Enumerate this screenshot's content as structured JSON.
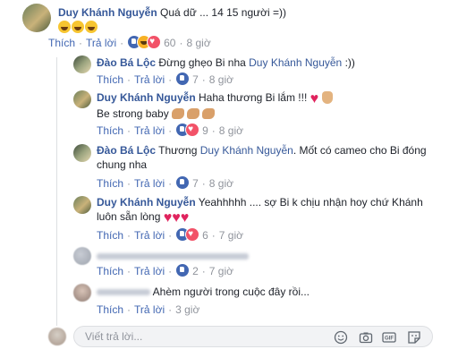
{
  "actions": {
    "like": "Thích",
    "reply": "Trả lời"
  },
  "comments": [
    {
      "author": "Duy Khánh Nguyễn",
      "text": "Quá dữ ... 14 15 người =))",
      "reaction_count": "60",
      "time": "8 giờ"
    },
    {
      "author": "Đào Bá Lộc",
      "text_before": "Đừng ghẹo Bi nha",
      "tag": "Duy Khánh Nguyễn",
      "text_after": ":))",
      "reaction_count": "7",
      "time": "8 giờ"
    },
    {
      "author": "Duy Khánh Nguyễn",
      "text": "Haha thương Bi lắm !!!",
      "line2": "Be strong baby",
      "reaction_count": "9",
      "time": "8 giờ"
    },
    {
      "author": "Đào Bá Lộc",
      "text_before": "Thương",
      "tag": "Duy Khánh Nguyễn",
      "text_after": ". Mốt có cameo cho Bi đóng",
      "line2": "chung nha",
      "reaction_count": "7",
      "time": "8 giờ"
    },
    {
      "author": "Duy Khánh Nguyễn",
      "text": "Yeahhhhh .... sợ Bi k chịu nhận hoy chứ Khánh",
      "line2": "luôn sẵn lòng",
      "reaction_count": "6",
      "time": "7 giờ"
    },
    {
      "reaction_count": "2",
      "time": "7 giờ"
    },
    {
      "text": "Ahèm người trong cuộc đây rồi...",
      "time": "3 giờ"
    }
  ],
  "reply_box": {
    "placeholder": "Viết trả lời..."
  },
  "colors": {
    "link": "#365899",
    "action": "#4267b2",
    "meta": "#90949c",
    "like": "#4267b2",
    "love": "#f25268"
  }
}
